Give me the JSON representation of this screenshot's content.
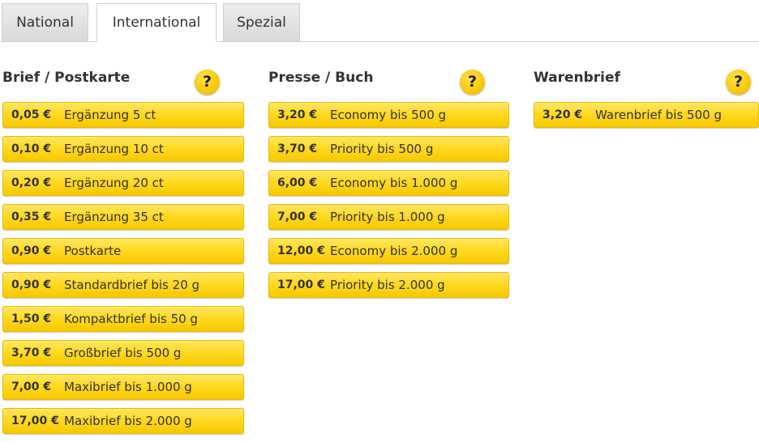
{
  "tabs": [
    {
      "label": "National"
    },
    {
      "label": "International"
    },
    {
      "label": "Spezial"
    }
  ],
  "columns": {
    "brief": {
      "title": "Brief / Postkarte",
      "help": "?",
      "items": [
        {
          "price": "0,05 €",
          "label": "Ergänzung 5 ct"
        },
        {
          "price": "0,10 €",
          "label": "Ergänzung 10 ct"
        },
        {
          "price": "0,20 €",
          "label": "Ergänzung 20 ct"
        },
        {
          "price": "0,35 €",
          "label": "Ergänzung 35 ct"
        },
        {
          "price": "0,90 €",
          "label": "Postkarte"
        },
        {
          "price": "0,90 €",
          "label": "Standardbrief bis 20 g"
        },
        {
          "price": "1,50 €",
          "label": "Kompaktbrief bis 50 g"
        },
        {
          "price": "3,70 €",
          "label": "Großbrief bis 500 g"
        },
        {
          "price": "7,00 €",
          "label": "Maxibrief bis 1.000 g"
        },
        {
          "price": "17,00 €",
          "label": "Maxibrief bis 2.000 g"
        }
      ]
    },
    "presse": {
      "title": "Presse / Buch",
      "help": "?",
      "items": [
        {
          "price": "3,20 €",
          "label": "Economy bis 500 g"
        },
        {
          "price": "3,70 €",
          "label": "Priority bis 500 g"
        },
        {
          "price": "6,00 €",
          "label": "Economy bis 1.000 g"
        },
        {
          "price": "7,00 €",
          "label": "Priority bis 1.000 g"
        },
        {
          "price": "12,00 €",
          "label": "Economy bis 2.000 g"
        },
        {
          "price": "17,00 €",
          "label": "Priority bis 2.000 g"
        }
      ]
    },
    "waren": {
      "title": "Warenbrief",
      "help": "?",
      "items": [
        {
          "price": "3,20 €",
          "label": "Warenbrief bis 500 g"
        }
      ]
    }
  },
  "colors": {
    "button_yellow": "#ffd923",
    "help_yellow": "#f7c400",
    "text": "#333333"
  }
}
